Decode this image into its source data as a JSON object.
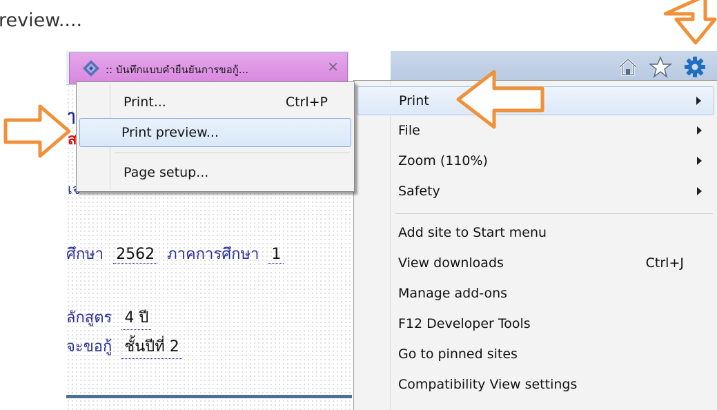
{
  "caption": "review....",
  "tab": {
    "title": ":: บันทึกแบบคำยืนยันการขอกู้...",
    "close": "✕"
  },
  "toolbar_icons": [
    "home-icon",
    "star-icon",
    "gear-icon"
  ],
  "page": {
    "frag_a": "ๅ",
    "frag_b": "ส",
    "frag_c": "เจ",
    "row1": {
      "label": "ศึกษา",
      "value": "2562",
      "label2": "ภาคการศึกษา",
      "value2": "1"
    },
    "row2": {
      "label": "ลักสูตร",
      "value": "4 ปี"
    },
    "row3": {
      "label": "จะขอกู้",
      "value": "ชั้นปีที่ 2"
    }
  },
  "print_submenu": {
    "items": [
      {
        "label": "Print...",
        "shortcut": "Ctrl+P"
      },
      {
        "label": "Print preview..."
      },
      {
        "label": "Page setup..."
      }
    ]
  },
  "tools_menu": {
    "items": [
      {
        "label": "Print",
        "submenu": true
      },
      {
        "label": "File",
        "submenu": true
      },
      {
        "label": "Zoom (110%)",
        "submenu": true
      },
      {
        "label": "Safety",
        "submenu": true
      },
      {
        "label": "Add site to Start menu"
      },
      {
        "label": "View downloads",
        "shortcut": "Ctrl+J"
      },
      {
        "label": "Manage add-ons"
      },
      {
        "label": "F12 Developer Tools"
      },
      {
        "label": "Go to pinned sites"
      },
      {
        "label": "Compatibility View settings"
      }
    ]
  },
  "colors": {
    "annotation_arrow": "#f0913a",
    "tab": "#d887df",
    "toolbar": "#b7c8e0",
    "highlight_border": "#84acdd"
  }
}
